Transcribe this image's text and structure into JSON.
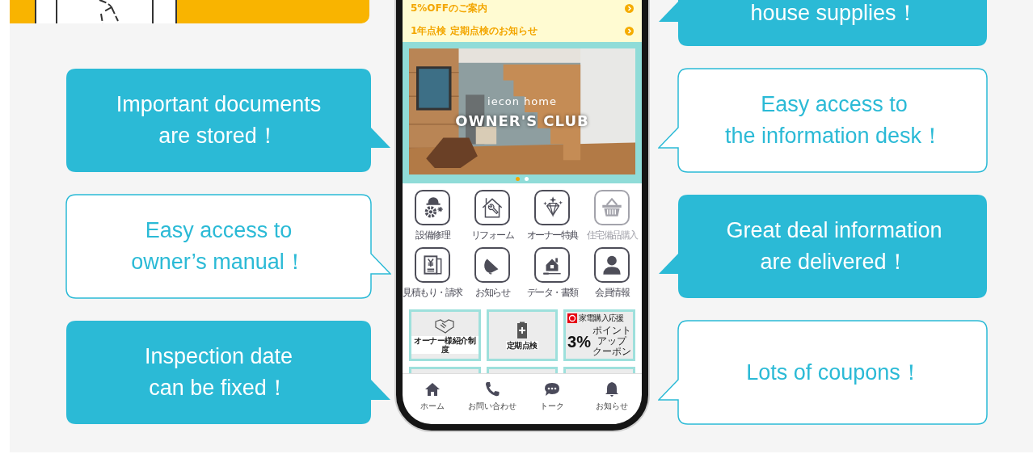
{
  "callouts_left": [
    {
      "kind": "filled",
      "text": "Important documents\nare stored！"
    },
    {
      "kind": "outline",
      "text": "Easy access to\nowner’s manual！"
    },
    {
      "kind": "filled",
      "text": "Inspection date\ncan be fixed！"
    }
  ],
  "callouts_right": [
    {
      "kind": "filled",
      "text": "house supplies！"
    },
    {
      "kind": "outline",
      "text": "Easy access to\nthe information desk！"
    },
    {
      "kind": "filled",
      "text": "Great deal information\nare delivered！"
    },
    {
      "kind": "outline",
      "text": "Lots of coupons！"
    }
  ],
  "phone": {
    "notices": [
      {
        "text": "5%OFFのご案内"
      },
      {
        "text": "1年点検 定期点検のお知らせ"
      }
    ],
    "banner": {
      "brand": "iecon home",
      "title": "OWNER'S CLUB",
      "dots": [
        {
          "selected": true
        },
        {
          "selected": false
        }
      ]
    },
    "menu": [
      {
        "label": "設備修理",
        "disabled": false
      },
      {
        "label": "リフォーム",
        "disabled": false
      },
      {
        "label": "オーナー特典",
        "disabled": false
      },
      {
        "label": "住宅備品購入",
        "disabled": true
      },
      {
        "label": "見積もり・請求",
        "disabled": false
      },
      {
        "label": "お知らせ",
        "disabled": false
      },
      {
        "label": "データ・書類",
        "disabled": false
      },
      {
        "label": "会員情報",
        "disabled": false
      }
    ],
    "tiles": [
      {
        "kind": "icon",
        "label": "オーナー様紹介制度"
      },
      {
        "kind": "icon",
        "label": "定期点検"
      },
      {
        "kind": "coupon",
        "caption": "家電購入応援",
        "value": "3%",
        "note_lines": [
          "ポイント",
          "アップ",
          "クーポン"
        ]
      }
    ],
    "nav": [
      {
        "label": "ホーム"
      },
      {
        "label": "お問い合わせ"
      },
      {
        "label": "トーク"
      },
      {
        "label": "お知らせ"
      }
    ]
  }
}
